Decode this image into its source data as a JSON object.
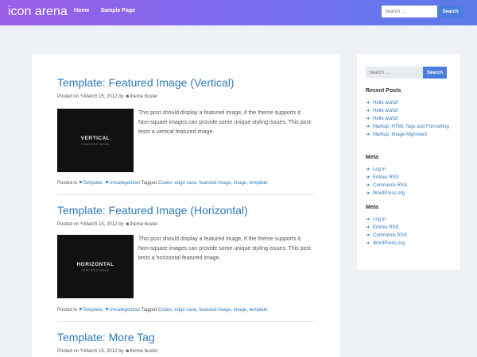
{
  "header": {
    "site_title": "icon arena",
    "nav": [
      "Home",
      "Sample Page"
    ],
    "search_placeholder": "Search ...",
    "search_button": "Search"
  },
  "posts": [
    {
      "title": "Template: Featured Image (Vertical)",
      "posted_on": "Posted on",
      "date": "March 15, 2012",
      "by": "by",
      "author": "theme buster",
      "thumb_text": "VERTICAL",
      "thumb_sub": "FEATURED IMAGE",
      "excerpt": "This post should display a featured image, if the theme supports it. Non-square images can provide some unique styling issues. This post tests a vertical featured image.",
      "posted_in": "Posted in",
      "cat1": "Template",
      "cat2": "Uncategorized",
      "tagged": "Tagged",
      "tags": [
        "Codex",
        "edge case",
        "featured image",
        "image",
        "template"
      ]
    },
    {
      "title": "Template: Featured Image (Horizontal)",
      "posted_on": "Posted on",
      "date": "March 15, 2012",
      "by": "by",
      "author": "theme buster",
      "thumb_text": "HORIZONTAL",
      "thumb_sub": "FEATURED IMAGE",
      "excerpt": "This post should display a featured image, if the theme supports it. Non-square images can provide some unique styling issues. This post tests a horizontal featured image.",
      "posted_in": "Posted in",
      "cat1": "Template",
      "cat2": "Uncategorized",
      "tagged": "Tagged",
      "tags": [
        "Codex",
        "edge case",
        "featured image",
        "image",
        "template"
      ]
    },
    {
      "title": "Template: More Tag",
      "posted_on": "Posted on",
      "date": "March 15, 2012",
      "by": "by",
      "author": "theme buster"
    }
  ],
  "sidebar": {
    "search_placeholder": "Search ...",
    "search_button": "Search",
    "recent_title": "Recent Posts",
    "recent": [
      "Hello world!",
      "Hello world!",
      "Hello world!",
      "Markup: HTML Tags and Formatting",
      "Markup: Image Alignment"
    ],
    "meta1_title": "Meta",
    "meta1": [
      "Log in",
      "Entries RSS",
      "Comments RSS",
      "WordPress.org"
    ],
    "meta2_title": "Meta",
    "meta2": [
      "Log in",
      "Entries RSS",
      "Comments RSS",
      "WordPress.org"
    ]
  },
  "colors": {
    "accent": "#4a7ddc",
    "link": "#2f79b9",
    "header_start": "#9b5de5",
    "header_end": "#5a7be8"
  },
  "icons": {
    "date": "pencil-icon",
    "author": "user-icon",
    "category": "tag-icon",
    "list": "arrow-icon"
  }
}
